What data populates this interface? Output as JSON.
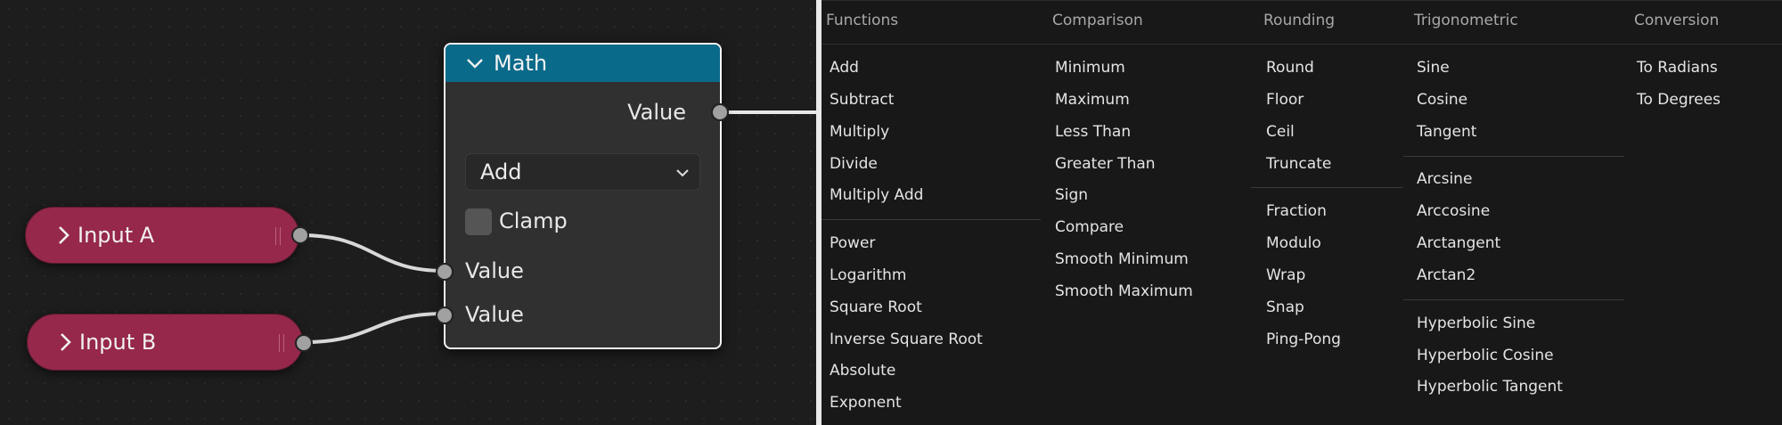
{
  "node_editor": {
    "math_node": {
      "title": "Math",
      "output_label": "Value",
      "operation": "Add",
      "clamp_label": "Clamp",
      "clamp_checked": false,
      "inputs": [
        "Value",
        "Value"
      ],
      "header_color": "#0a6a8a"
    },
    "reroutes": [
      {
        "label": "Input A"
      },
      {
        "label": "Input B"
      }
    ],
    "reroute_color": "#96284b"
  },
  "menu": {
    "columns": [
      {
        "title": "Functions",
        "groups": [
          [
            "Add",
            "Subtract",
            "Multiply",
            "Divide",
            "Multiply Add"
          ],
          [
            "Power",
            "Logarithm",
            "Square Root",
            "Inverse Square Root",
            "Absolute",
            "Exponent"
          ]
        ]
      },
      {
        "title": "Comparison",
        "groups": [
          [
            "Minimum",
            "Maximum",
            "Less Than",
            "Greater Than",
            "Sign",
            "Compare",
            "Smooth Minimum",
            "Smooth Maximum"
          ]
        ]
      },
      {
        "title": "Rounding",
        "groups": [
          [
            "Round",
            "Floor",
            "Ceil",
            "Truncate"
          ],
          [
            "Fraction",
            "Modulo",
            "Wrap",
            "Snap",
            "Ping-Pong"
          ]
        ]
      },
      {
        "title": "Trigonometric",
        "groups": [
          [
            "Sine",
            "Cosine",
            "Tangent"
          ],
          [
            "Arcsine",
            "Arccosine",
            "Arctangent",
            "Arctan2"
          ],
          [
            "Hyperbolic Sine",
            "Hyperbolic Cosine",
            "Hyperbolic Tangent"
          ]
        ]
      },
      {
        "title": "Conversion",
        "groups": [
          [
            "To Radians",
            "To Degrees"
          ]
        ]
      }
    ]
  }
}
